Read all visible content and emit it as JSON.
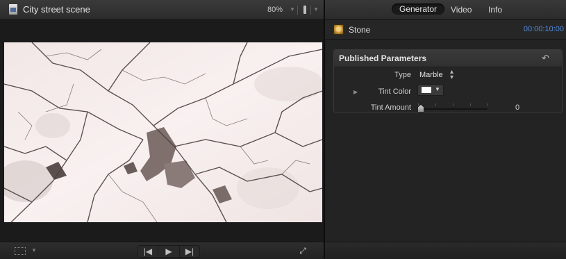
{
  "viewer": {
    "title": "City street scene",
    "zoom": "80%",
    "zoom_menu_icon": "triangle-down",
    "view_options_icon": "view-options",
    "controls": {
      "transform_icon": "transform-crop",
      "prev_icon": "skip-previous",
      "play_icon": "play",
      "next_icon": "skip-next",
      "fullscreen_icon": "expand-arrows"
    }
  },
  "inspector": {
    "tabs": [
      {
        "label": "Generator",
        "active": true
      },
      {
        "label": "Video",
        "active": false
      },
      {
        "label": "Info",
        "active": false
      }
    ],
    "clip": {
      "name": "Stone",
      "duration": "00:00:10:00",
      "icon": "generator-icon"
    },
    "published_parameters": {
      "title": "Published Parameters",
      "reset_icon": "reset-arrow",
      "type": {
        "label": "Type",
        "value": "Marble"
      },
      "tint_color": {
        "label": "Tint Color",
        "color": "#ffffff"
      },
      "tint_amount": {
        "label": "Tint Amount",
        "value": "0"
      }
    }
  },
  "colors": {
    "accent_timecode": "#4f8de0",
    "panel_bg": "#232323"
  }
}
